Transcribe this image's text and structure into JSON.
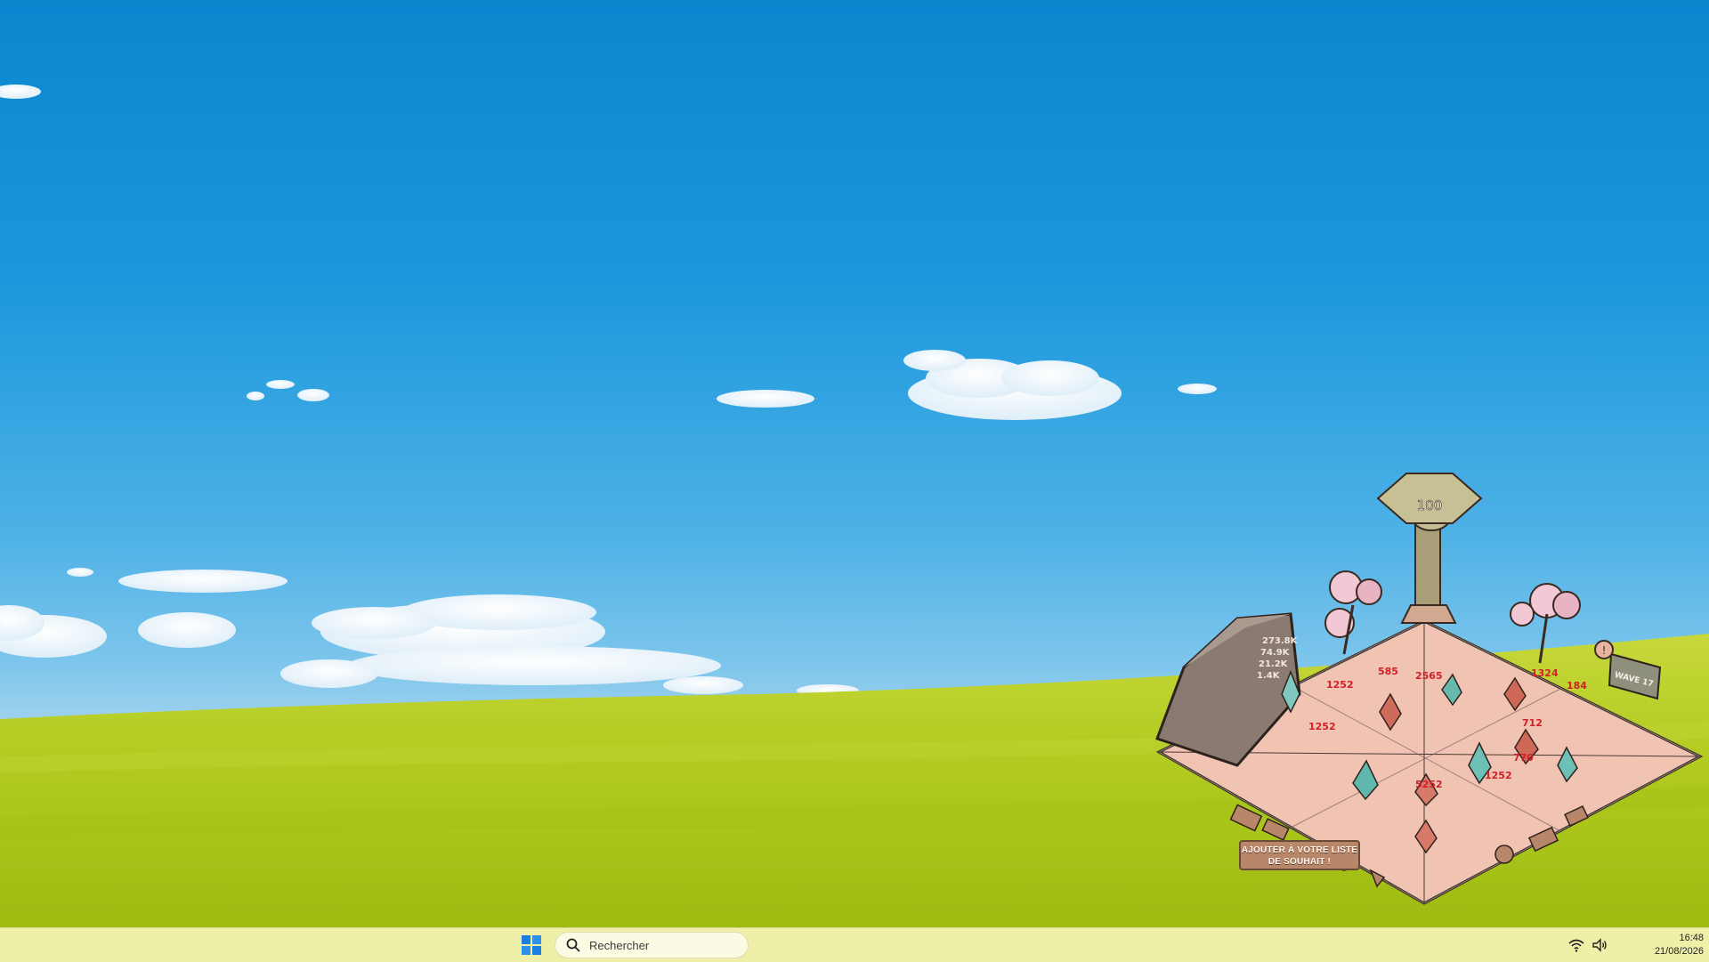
{
  "game": {
    "crystal_counter": "100",
    "wave_label": "WAVE 17",
    "score_lines": [
      "273.8K",
      "74.9K",
      "21.2K",
      "1.4K"
    ],
    "damage_numbers": [
      "1252",
      "585",
      "2565",
      "1252",
      "770",
      "1252",
      "1324",
      "184",
      "712",
      "5252"
    ],
    "wishlist_line1": "AJOUTER À VOTRE LISTE",
    "wishlist_line2": "DE SOUHAIT !"
  },
  "taskbar": {
    "search_placeholder": "Rechercher",
    "icons": {
      "start": "windows-start-icon",
      "search": "search-icon",
      "wifi": "wifi-icon",
      "volume": "volume-icon"
    }
  },
  "clock": {
    "time": "16:48",
    "date": "21/08/2026"
  },
  "colors": {
    "sky": "#1a97dc",
    "grass": "#b4cf2a",
    "taskbar": "#eff0a8",
    "board": "#f0c3b3",
    "damage": "#d0202a"
  }
}
